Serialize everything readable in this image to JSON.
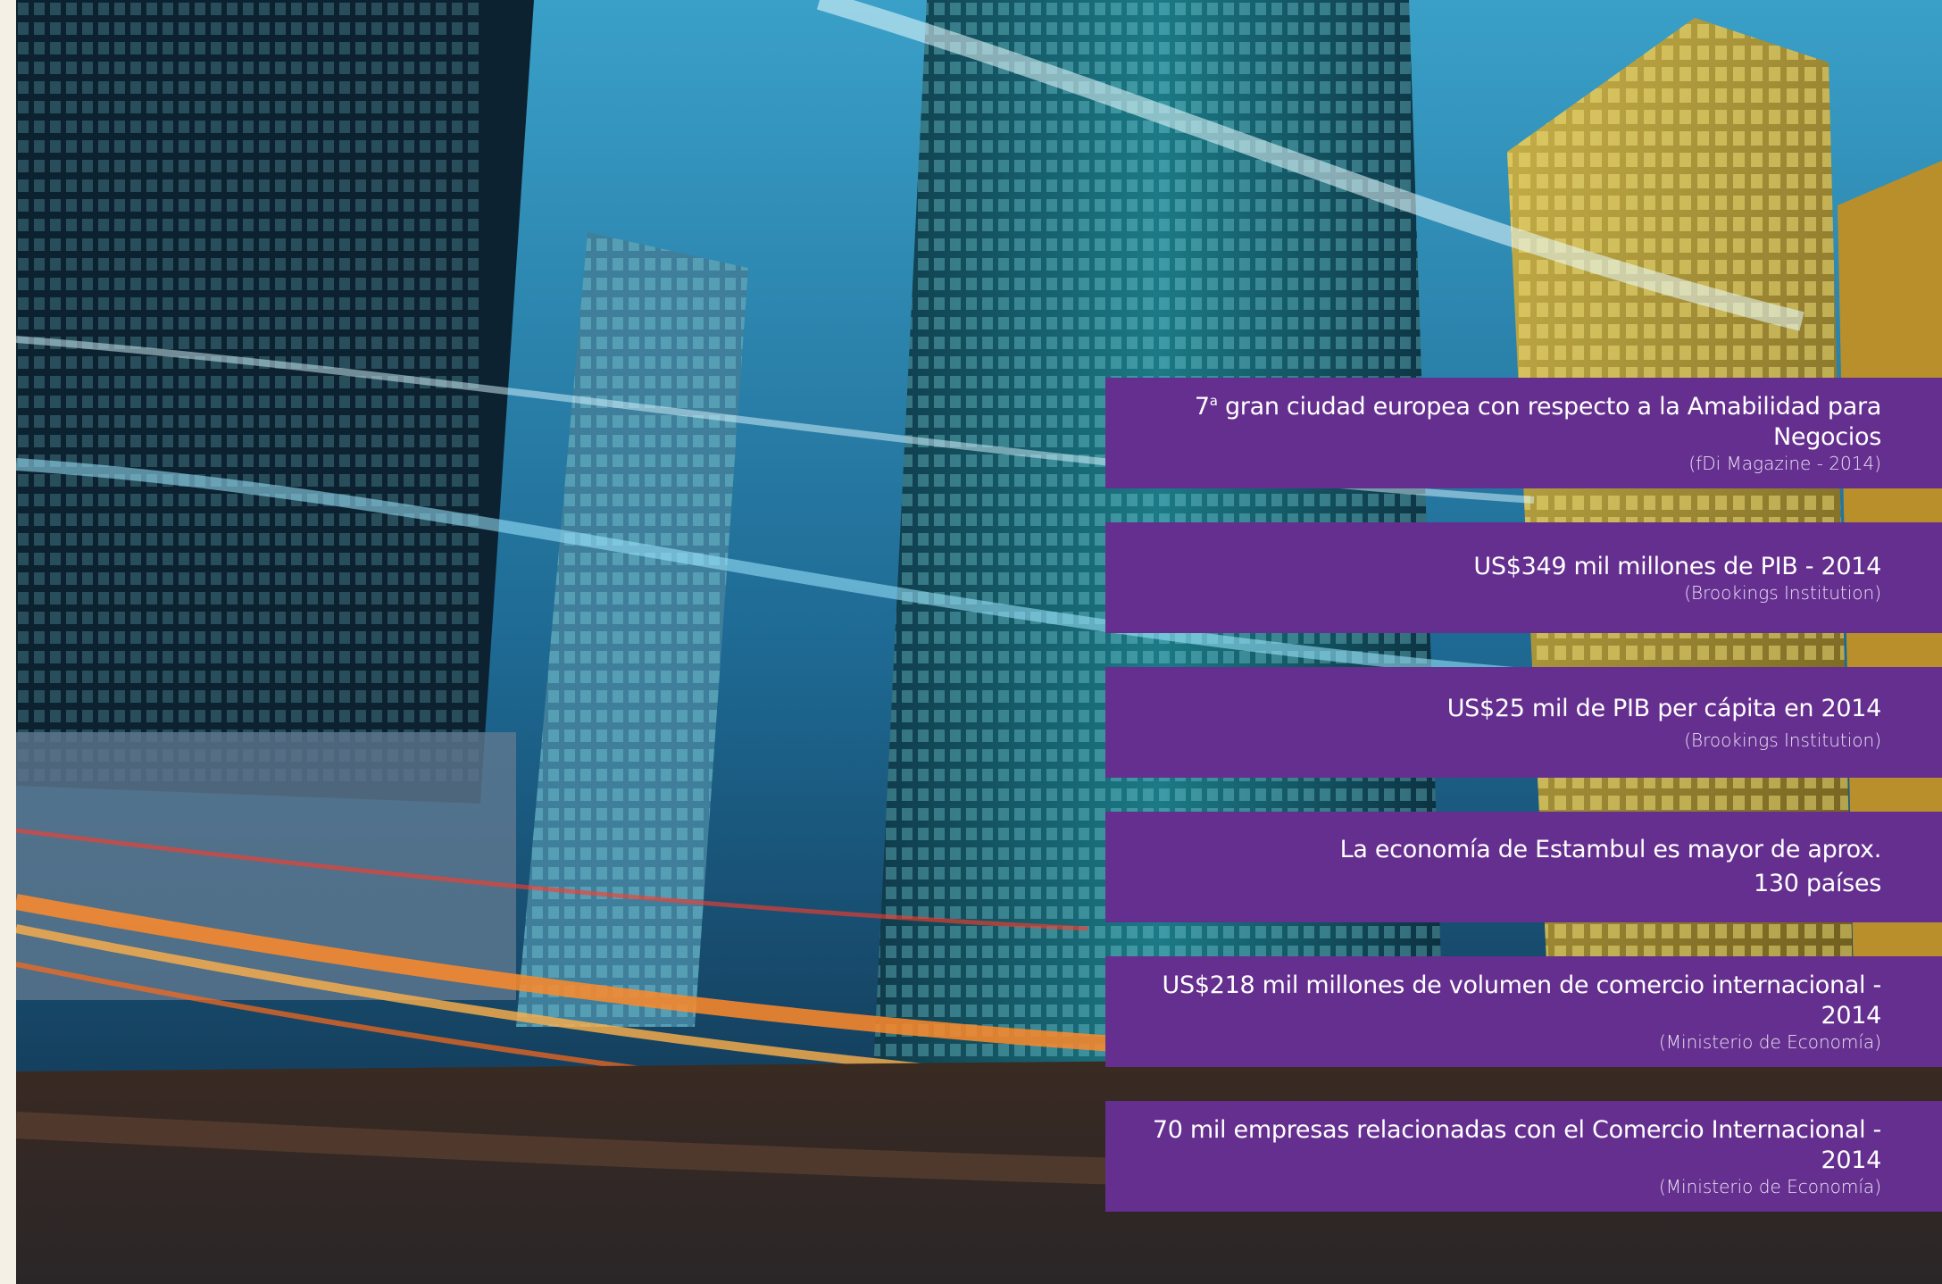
{
  "stats": [
    {
      "main": "7",
      "sup": "a",
      "main_rest": " gran ciudad europea con respecto a la Amabilidad para Negocios",
      "source": "(fDi Magazine - 2014)"
    },
    {
      "main": "US$349 mil millones de PIB - 2014",
      "source": "(Brookings Institution)"
    },
    {
      "main": "US$25 mil de PIB per cápita en 2014",
      "source": "(Brookings Institution)"
    },
    {
      "main": "La economía de Estambul es mayor de aprox.",
      "main2": "130 países"
    },
    {
      "main": "US$218 mil millones de volumen de comercio internacional - 2014",
      "source": "(Ministerio de Economía)"
    },
    {
      "main": "70 mil empresas relacionadas con el Comercio Internacional - 2014",
      "source": "(Ministerio de Economía)"
    }
  ],
  "colors": {
    "panel": "#652f8f",
    "text": "#ffffff"
  }
}
